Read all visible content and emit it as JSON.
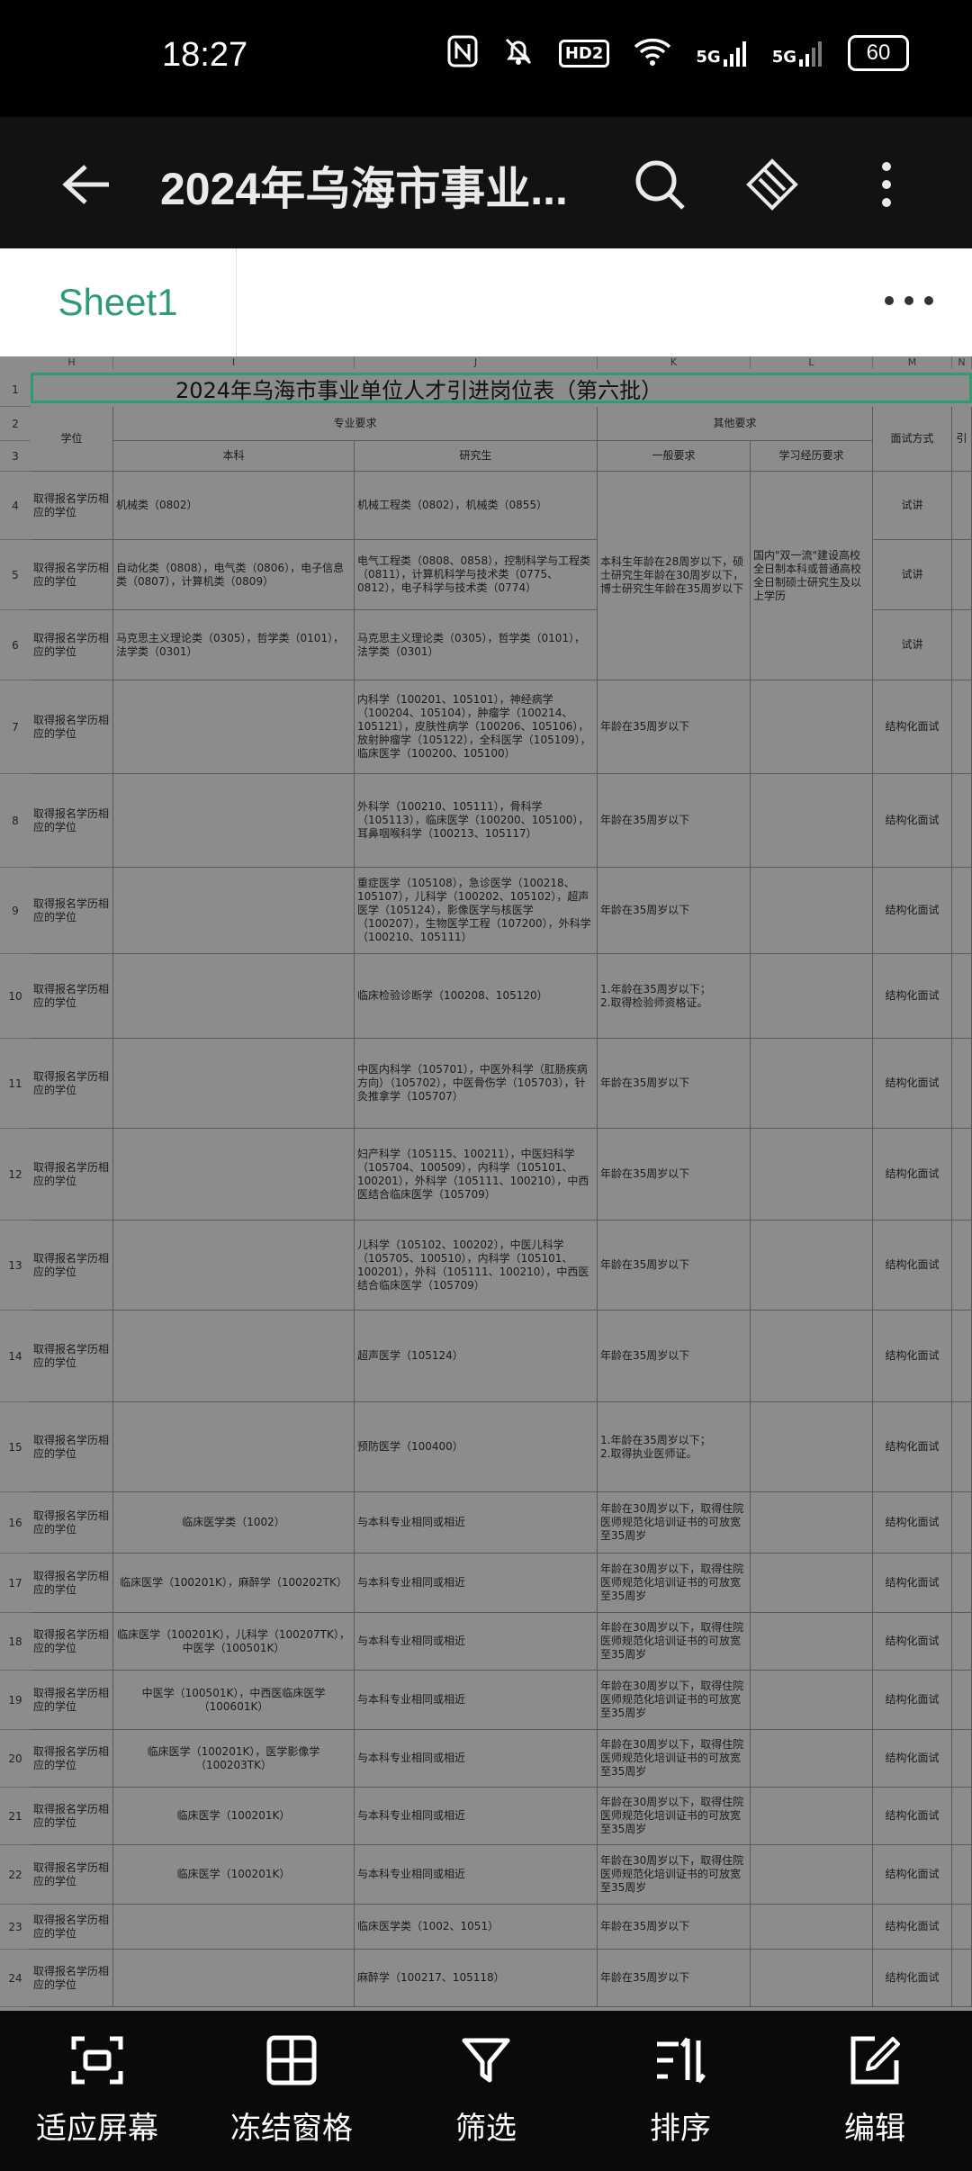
{
  "status": {
    "time": "18:27",
    "battery": "60",
    "network1": "5G",
    "network2": "5G",
    "hd": "HD2"
  },
  "appbar": {
    "title": "2024年乌海市事业..."
  },
  "tabs": {
    "sheet": "Sheet1"
  },
  "columns": [
    "H",
    "I",
    "J",
    "K",
    "L",
    "M",
    "N"
  ],
  "sheet_title": "2024年乌海市事业单位人才引进岗位表（第六批）",
  "headers": {
    "degree": "学位",
    "major_req": "专业要求",
    "undergrad": "本科",
    "grad": "研究生",
    "other_req": "其他要求",
    "general_req": "一般要求",
    "experience_req": "学习经历要求",
    "interview": "面试方式",
    "next": "引"
  },
  "rows": [
    {
      "num": "1"
    },
    {
      "num": "2"
    },
    {
      "num": "3"
    },
    {
      "num": "4",
      "degree": "取得报名学历相应的学位",
      "undergrad": "机械类（0802）",
      "grad": "机械工程类（0802），机械类（0855）",
      "interview": "试讲"
    },
    {
      "num": "5",
      "degree": "取得报名学历相应的学位",
      "undergrad": "自动化类（0808），电气类（0806），电子信息类（0807），计算机类（0809）",
      "grad": "电气工程类（0808、0858），控制科学与工程类（0811），计算机科学与技术类（0775、0812），电子科学与技术类（0774）",
      "general": "本科生年龄在28周岁以下，硕士研究生年龄在30周岁以下，博士研究生年龄在35周岁以下",
      "experience": "国内\"双一流\"建设高校全日制本科或普通高校全日制硕士研究生及以上学历",
      "interview": "试讲"
    },
    {
      "num": "6",
      "degree": "取得报名学历相应的学位",
      "undergrad": "马克思主义理论类（0305），哲学类（0101），法学类（0301）",
      "grad": "马克思主义理论类（0305），哲学类（0101），法学类（0301）",
      "interview": "试讲"
    },
    {
      "num": "7",
      "degree": "取得报名学历相应的学位",
      "grad": "内科学（100201、105101），神经病学（100204、105104），肿瘤学（100214、105121），皮肤性病学（100206、105106），放射肿瘤学（105122），全科医学（105109），临床医学（100200、105100）",
      "general": "年龄在35周岁以下",
      "interview": "结构化面试"
    },
    {
      "num": "8",
      "degree": "取得报名学历相应的学位",
      "grad": "外科学（100210、105111），骨科学（105113），临床医学（100200、105100），耳鼻咽喉科学（100213、105117）",
      "general": "年龄在35周岁以下",
      "interview": "结构化面试"
    },
    {
      "num": "9",
      "degree": "取得报名学历相应的学位",
      "grad": "重症医学（105108），急诊医学（100218、105107），儿科学（100202、105102），超声医学（105124），影像医学与核医学（100207），生物医学工程（107200），外科学（100210、105111）",
      "general": "年龄在35周岁以下",
      "interview": "结构化面试"
    },
    {
      "num": "10",
      "degree": "取得报名学历相应的学位",
      "grad": "临床检验诊断学（100208、105120）",
      "general": "1.年龄在35周岁以下；\n2.取得检验师资格证。",
      "interview": "结构化面试"
    },
    {
      "num": "11",
      "degree": "取得报名学历相应的学位",
      "grad": "中医内科学（105701），中医外科学（肛肠疾病方向）（105702），中医骨伤学（105703），针灸推拿学（105707）",
      "general": "年龄在35周岁以下",
      "interview": "结构化面试"
    },
    {
      "num": "12",
      "degree": "取得报名学历相应的学位",
      "grad": "妇产科学（105115、100211），中医妇科学（105704、100509），内科学（105101、100201），外科学（105111、100210），中西医结合临床医学（105709）",
      "general": "年龄在35周岁以下",
      "interview": "结构化面试"
    },
    {
      "num": "13",
      "degree": "取得报名学历相应的学位",
      "grad": "儿科学（105102、100202），中医儿科学（105705、100510），内科学（105101、100201），外科（105111、100210），中西医结合临床医学（105709）",
      "general": "年龄在35周岁以下",
      "interview": "结构化面试"
    },
    {
      "num": "14",
      "degree": "取得报名学历相应的学位",
      "grad": "超声医学（105124）",
      "general": "年龄在35周岁以下",
      "interview": "结构化面试"
    },
    {
      "num": "15",
      "degree": "取得报名学历相应的学位",
      "grad": "预防医学（100400）",
      "general": "1.年龄在35周岁以下；\n2.取得执业医师证。",
      "interview": "结构化面试"
    },
    {
      "num": "16",
      "degree": "取得报名学历相应的学位",
      "undergrad": "临床医学类（1002）",
      "grad": "与本科专业相同或相近",
      "general": "年龄在30周岁以下，取得住院医师规范化培训证书的可放宽至35周岁",
      "interview": "结构化面试"
    },
    {
      "num": "17",
      "degree": "取得报名学历相应的学位",
      "undergrad": "临床医学（100201K），麻醉学（100202TK）",
      "grad": "与本科专业相同或相近",
      "general": "年龄在30周岁以下，取得住院医师规范化培训证书的可放宽至35周岁",
      "interview": "结构化面试"
    },
    {
      "num": "18",
      "degree": "取得报名学历相应的学位",
      "undergrad": "临床医学（100201K），儿科学（100207TK），中医学（100501K）",
      "grad": "与本科专业相同或相近",
      "general": "年龄在30周岁以下，取得住院医师规范化培训证书的可放宽至35周岁",
      "interview": "结构化面试"
    },
    {
      "num": "19",
      "degree": "取得报名学历相应的学位",
      "undergrad": "中医学（100501K），中西医临床医学（100601K）",
      "grad": "与本科专业相同或相近",
      "general": "年龄在30周岁以下，取得住院医师规范化培训证书的可放宽至35周岁",
      "interview": "结构化面试"
    },
    {
      "num": "20",
      "degree": "取得报名学历相应的学位",
      "undergrad": "临床医学（100201K），医学影像学（100203TK）",
      "grad": "与本科专业相同或相近",
      "general": "年龄在30周岁以下，取得住院医师规范化培训证书的可放宽至35周岁",
      "interview": "结构化面试"
    },
    {
      "num": "21",
      "degree": "取得报名学历相应的学位",
      "undergrad": "临床医学（100201K）",
      "grad": "与本科专业相同或相近",
      "general": "年龄在30周岁以下，取得住院医师规范化培训证书的可放宽至35周岁",
      "interview": "结构化面试"
    },
    {
      "num": "22",
      "degree": "取得报名学历相应的学位",
      "undergrad": "临床医学（100201K）",
      "grad": "与本科专业相同或相近",
      "general": "年龄在30周岁以下，取得住院医师规范化培训证书的可放宽至35周岁",
      "interview": "结构化面试"
    },
    {
      "num": "23",
      "degree": "取得报名学历相应的学位",
      "grad": "临床医学类（1002、1051）",
      "general": "年龄在35周岁以下",
      "interview": "结构化面试"
    },
    {
      "num": "24",
      "degree": "取得报名学历相应的学位",
      "grad": "麻醉学（100217、105118）",
      "general": "年龄在35周岁以下",
      "interview": "结构化面试"
    }
  ],
  "bottom_actions": [
    {
      "label": "适应屏幕",
      "icon": "fit-screen-icon"
    },
    {
      "label": "冻结窗格",
      "icon": "freeze-pane-icon"
    },
    {
      "label": "筛选",
      "icon": "filter-icon"
    },
    {
      "label": "排序",
      "icon": "sort-icon"
    },
    {
      "label": "编辑",
      "icon": "edit-icon"
    }
  ]
}
